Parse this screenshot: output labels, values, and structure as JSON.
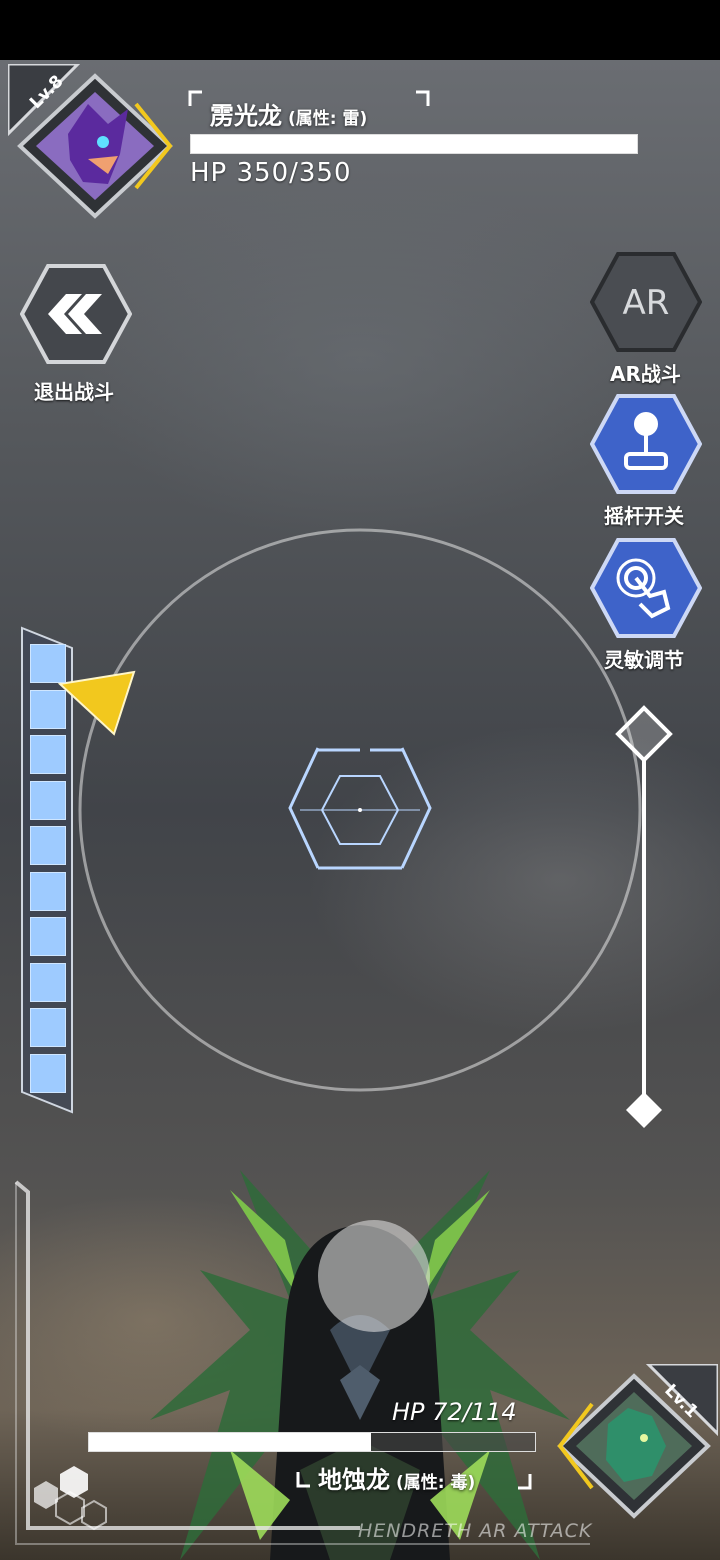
{
  "player": {
    "level": "Lv.8",
    "name": "雳光龙",
    "attribute": "(属性: 雷)",
    "hp_text": "HP 350/350",
    "hp_fraction": 1.0
  },
  "enemy": {
    "level": "Lv.1",
    "name": "地蚀龙",
    "attribute": "(属性: 毒)",
    "hp_text": "HP 72/114",
    "hp_fraction": 0.632
  },
  "buttons": {
    "exit_label": "退出战斗",
    "ar_icon_text": "AR",
    "ar_label": "AR战斗",
    "joystick_label": "摇杆开关",
    "sensitivity_label": "灵敏调节"
  },
  "energy": {
    "segments": 10,
    "filled": 10
  },
  "footer_text": "HENDRETH AR ATTACK",
  "colors": {
    "accent_yellow": "#f2c81e",
    "energy_blue": "#9ecbff",
    "button_blue": "#3e63c9",
    "button_gray": "#4a4d52"
  }
}
